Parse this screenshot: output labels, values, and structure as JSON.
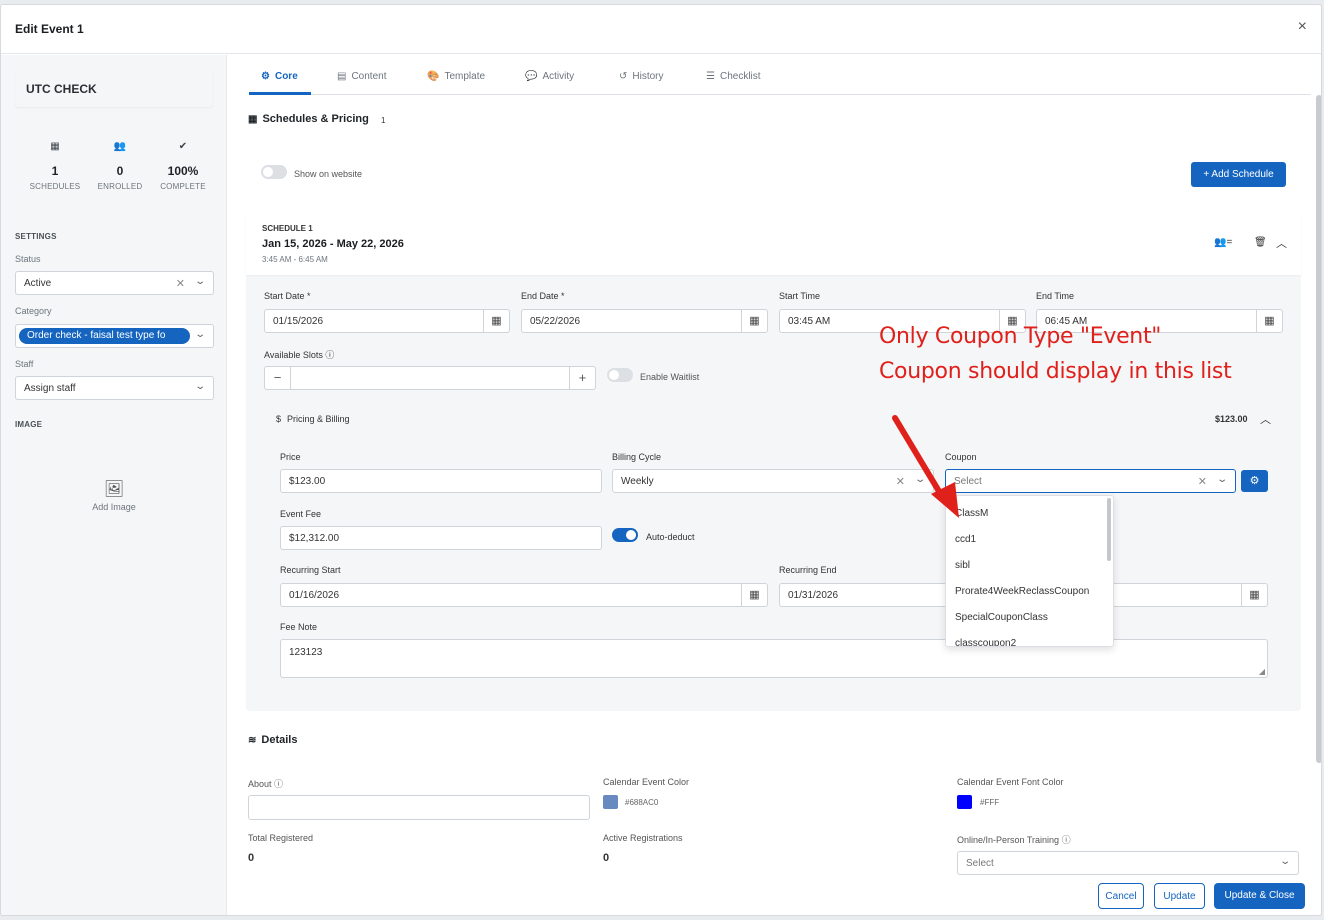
{
  "modal": {
    "title": "Edit Event 1",
    "close": "×"
  },
  "sidebar": {
    "event_name": "UTC CHECK",
    "stats": [
      {
        "icon": "▦",
        "value": "1",
        "label": "SCHEDULES"
      },
      {
        "icon": "👥",
        "value": "0",
        "label": "ENROLLED"
      },
      {
        "icon": "✔",
        "value": "100%",
        "label": "COMPLETE"
      }
    ],
    "settings_heading": "SETTINGS",
    "status_label": "Status",
    "status_value": "Active",
    "category_label": "Category",
    "category_value": "Order check - faisal test type fo",
    "staff_label": "Staff",
    "staff_placeholder": "Assign staff",
    "image_heading": "IMAGE",
    "add_image_label": "Add Image"
  },
  "tabs": [
    {
      "icon": "⚙",
      "label": "Core"
    },
    {
      "icon": "▤",
      "label": "Content"
    },
    {
      "icon": "🎨",
      "label": "Template"
    },
    {
      "icon": "💬",
      "label": "Activity"
    },
    {
      "icon": "↺",
      "label": "History"
    },
    {
      "icon": "☰",
      "label": "Checklist"
    }
  ],
  "schedules": {
    "heading": "Schedules & Pricing",
    "count": "1",
    "show_on_website": "Show on website",
    "add_schedule": "+ Add Schedule",
    "schedule_label": "SCHEDULE 1",
    "date_range": "Jan 15, 2026 - May 22, 2026",
    "time_range": "3:45 AM - 6:45 AM",
    "start_date_label": "Start Date *",
    "start_date": "01/15/2026",
    "end_date_label": "End Date *",
    "end_date": "05/22/2026",
    "start_time_label": "Start Time",
    "start_time": "03:45 AM",
    "end_time_label": "End Time",
    "end_time": "06:45 AM",
    "available_slots_label": "Available Slots",
    "enable_waitlist": "Enable Waitlist"
  },
  "pricing": {
    "heading": "Pricing & Billing",
    "total": "$123.00",
    "price_label": "Price",
    "price": "$123.00",
    "billing_cycle_label": "Billing Cycle",
    "billing_cycle": "Weekly",
    "coupon_label": "Coupon",
    "coupon_placeholder": "Select",
    "event_fee_label": "Event Fee",
    "event_fee": "$12,312.00",
    "auto_deduct": "Auto-deduct",
    "recurring_start_label": "Recurring Start",
    "recurring_start": "01/16/2026",
    "recurring_end_label": "Recurring End",
    "recurring_end": "01/31/2026",
    "fee_note_label": "Fee Note",
    "fee_note": "123123"
  },
  "coupon_options": [
    "ClassM",
    "ccd1",
    "sibl",
    "Prorate4WeekReclassCoupon",
    "SpecialCouponClass",
    "classcoupon2"
  ],
  "annotation": {
    "line1": "Only Coupon Type \"Event\"",
    "line2": "Coupon should display in this list",
    "color": "#e0201b"
  },
  "details": {
    "heading": "Details",
    "about_label": "About",
    "calendar_color_label": "Calendar Event Color",
    "calendar_color": "#688AC0",
    "calendar_font_color_label": "Calendar Event Font Color",
    "calendar_font_color": "#FFF",
    "total_registered_label": "Total Registered",
    "total_registered": "0",
    "active_registrations_label": "Active Registrations",
    "active_registrations": "0",
    "training_label": "Online/In-Person Training",
    "training_placeholder": "Select"
  },
  "footer": {
    "cancel": "Cancel",
    "update": "Update",
    "update_close": "Update & Close"
  },
  "colors": {
    "primary": "#1565c0",
    "swatch_calendar": "#688AC0",
    "swatch_font": "#0000FF"
  }
}
